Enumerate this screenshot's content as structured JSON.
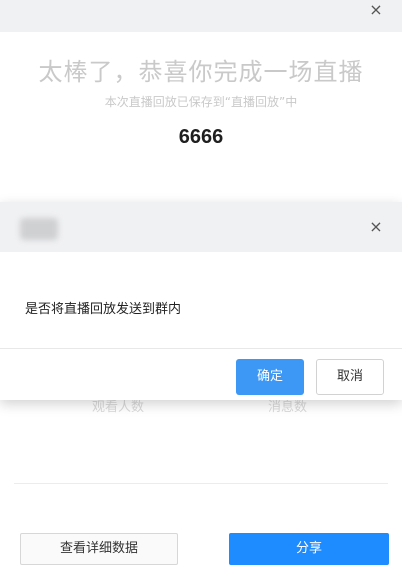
{
  "background_dialog": {
    "close_glyph": "×",
    "headline": "太棒了，恭喜你完成一场直播",
    "subline": "本次直播回放已保存到“直播回放”中",
    "value": "6666",
    "stats": {
      "left_label": "观看人数",
      "right_label": "消息数"
    },
    "detail_button_label": "查看详细数据",
    "share_button_label": "分享"
  },
  "confirm_dialog": {
    "close_glyph": "×",
    "message": "是否将直播回放发送到群内",
    "ok_label": "确定",
    "cancel_label": "取消"
  },
  "colors": {
    "primary": "#1e8bff",
    "ok_button": "#3d97f5",
    "header_bg": "#f0f1f3"
  }
}
